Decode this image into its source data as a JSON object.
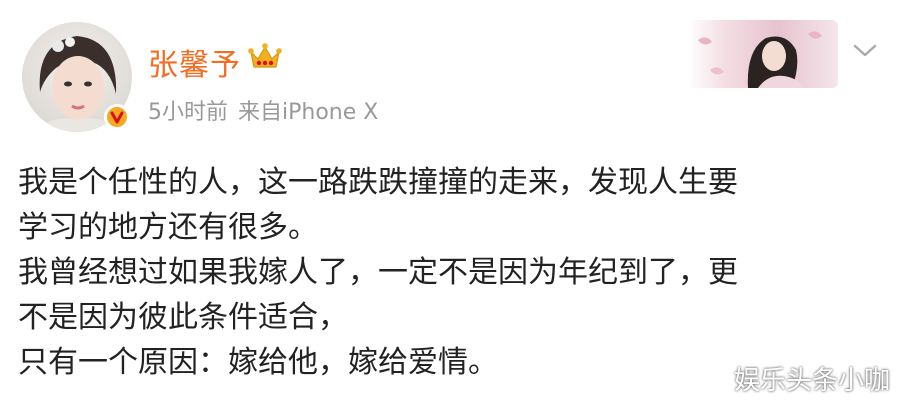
{
  "post": {
    "author": {
      "name": "张馨予",
      "avatar_icon": "avatar-photo",
      "badge_icon": "verified-v-icon",
      "member_icon": "crown-icon"
    },
    "meta": {
      "time": "5小时前",
      "source": "来自iPhone X"
    },
    "content_lines": [
      "我是个任性的人，这一路跌跌撞撞的走来，发现人生要",
      "学习的地方还有很多。",
      "我曾经想过如果我嫁人了，一定不是因为年纪到了，更",
      "不是因为彼此条件适合，",
      "只有一个原因：嫁给他，嫁给爱情。"
    ],
    "menu_icon": "chevron-down-icon"
  },
  "watermark": "娱乐头条小咖",
  "colors": {
    "name": "#f36c21",
    "meta": "#999999",
    "body_text": "#222222",
    "badge": "#f8a823",
    "crown": "#f2b01e"
  }
}
